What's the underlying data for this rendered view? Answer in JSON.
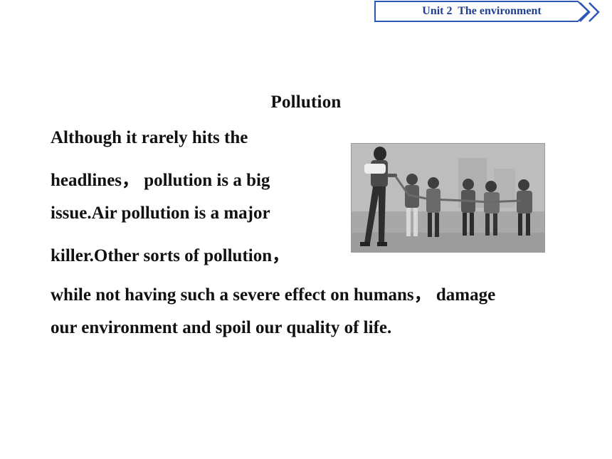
{
  "header": {
    "unit_label": "Unit 2  The environment",
    "accent_color": "#2c57b5"
  },
  "main": {
    "title": "Pollution",
    "lines": [
      "Although it rarely hits the",
      "headlines， pollution is a big",
      "issue.Air pollution is a major",
      "killer.Other sorts of pollution，",
      "while not having such a severe effect on humans， damage",
      "our environment and spoil our quality of life."
    ]
  },
  "image": {
    "icon": "grayscale-photo-children-walking-in-smog"
  }
}
